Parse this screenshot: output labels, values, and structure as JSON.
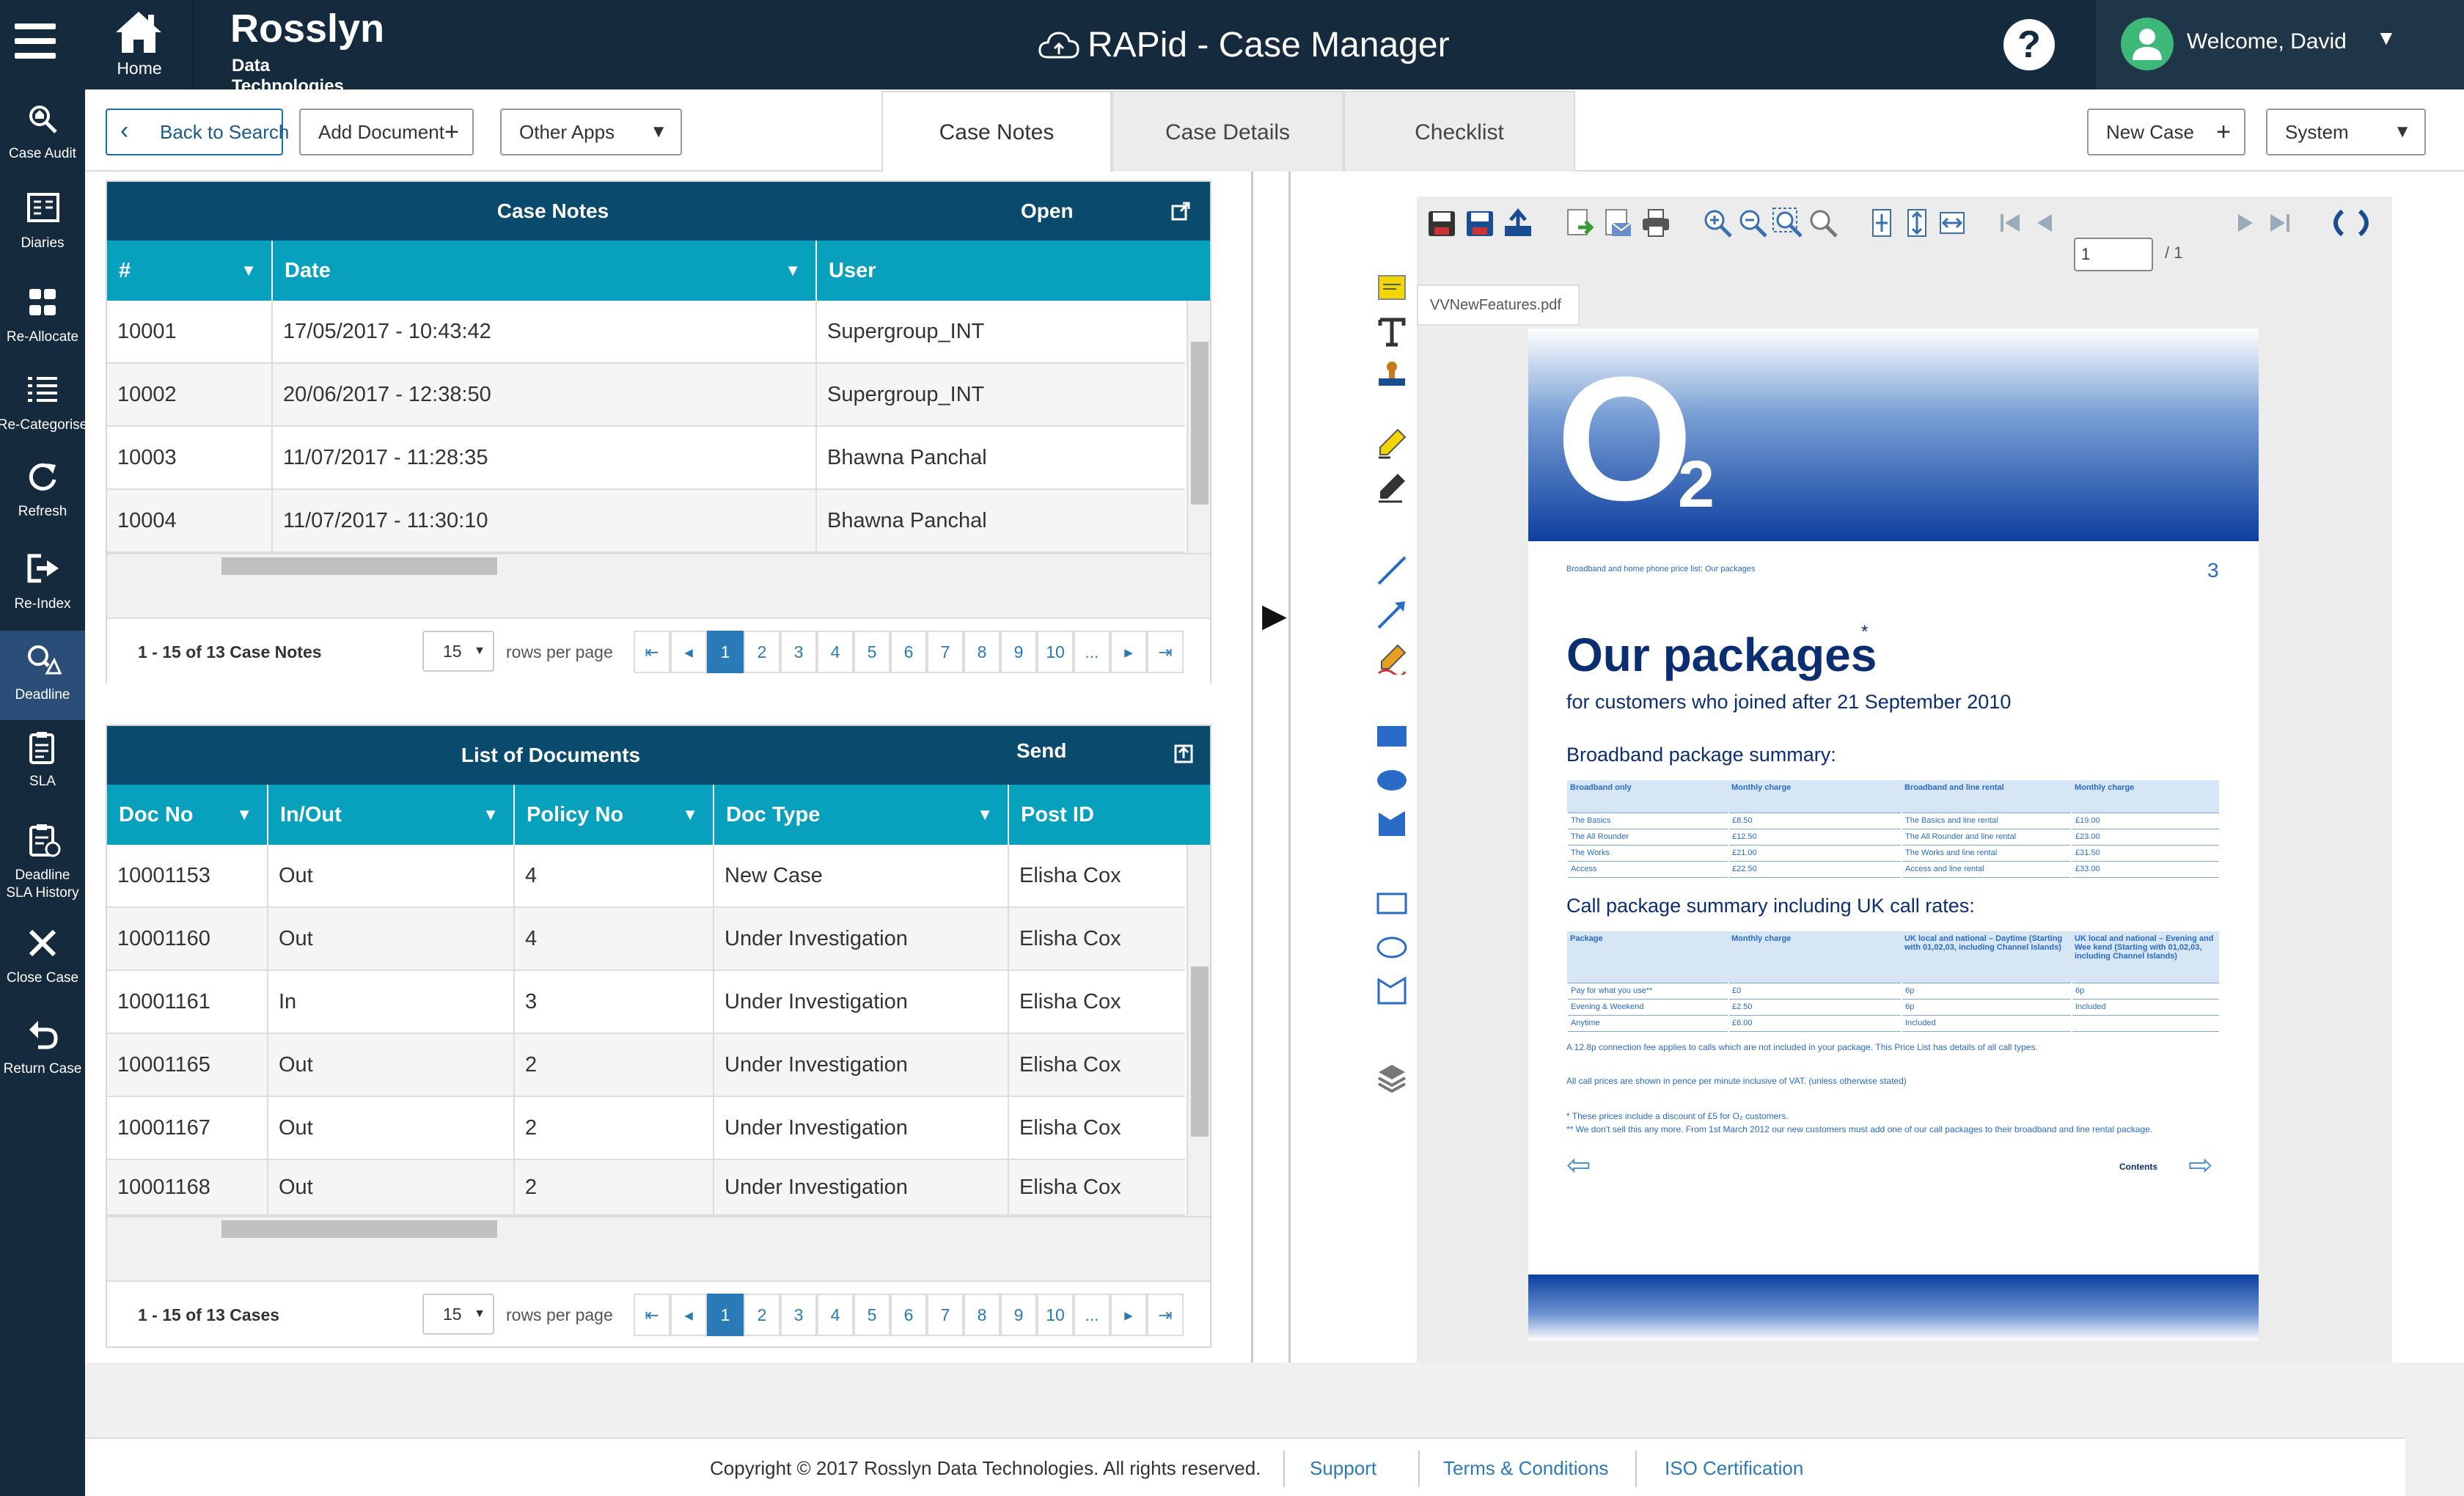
{
  "header": {
    "home_label": "Home",
    "brand_name": "Rosslyn",
    "brand_sub": "Data Technologies",
    "app_title": "RAPid - Case Manager",
    "help_label": "?",
    "welcome": "Welcome, David"
  },
  "sidebar": {
    "items": [
      {
        "label": "Case Audit",
        "icon": "case-audit-icon"
      },
      {
        "label": "Diaries",
        "icon": "diaries-icon"
      },
      {
        "label": "Re-Allocate",
        "icon": "re-allocate-icon"
      },
      {
        "label": "Re-Categorise",
        "icon": "list-icon"
      },
      {
        "label": "Refresh",
        "icon": "refresh-icon"
      },
      {
        "label": "Re-Index",
        "icon": "re-index-icon"
      },
      {
        "label": "Deadline",
        "icon": "deadline-icon"
      },
      {
        "label": "SLA",
        "icon": "sla-icon"
      },
      {
        "label": "Deadline SLA History",
        "icon": "sla-history-icon"
      },
      {
        "label": "Close Case",
        "icon": "close-icon"
      },
      {
        "label": "Return Case",
        "icon": "return-icon"
      }
    ]
  },
  "toolbar": {
    "back_label": "Back to Search",
    "add_doc_label": "Add Document",
    "other_apps_label": "Other Apps",
    "tabs": [
      "Case Notes",
      "Case Details",
      "Checklist"
    ],
    "new_case_label": "New Case",
    "system_label": "System"
  },
  "case_notes": {
    "title": "Case Notes",
    "action": "Open",
    "columns": [
      "#",
      "Date",
      "User"
    ],
    "rows": [
      [
        "10001",
        "17/05/2017 - 10:43:42",
        "Supergroup_INT"
      ],
      [
        "10002",
        "20/06/2017 - 12:38:50",
        "Supergroup_INT"
      ],
      [
        "10003",
        "11/07/2017 - 11:28:35",
        "Bhawna Panchal"
      ],
      [
        "10004",
        "11/07/2017 - 11:30:10",
        "Bhawna Panchal"
      ]
    ],
    "count": "1 - 15 of 13 Case Notes",
    "per_page": "15",
    "rows_per_page_label": "rows per page",
    "pages": [
      "1",
      "2",
      "3",
      "4",
      "5",
      "6",
      "7",
      "8",
      "9",
      "10",
      "..."
    ]
  },
  "documents": {
    "title": "List of Documents",
    "action": "Send",
    "columns": [
      "Doc No",
      "In/Out",
      "Policy No",
      "Doc Type",
      "Post ID"
    ],
    "rows": [
      [
        "10001153",
        "Out",
        "4",
        "New Case",
        "Elisha Cox"
      ],
      [
        "10001160",
        "Out",
        "4",
        "Under Investigation",
        "Elisha Cox"
      ],
      [
        "10001161",
        "In",
        "3",
        "Under Investigation",
        "Elisha Cox"
      ],
      [
        "10001165",
        "Out",
        "2",
        "Under Investigation",
        "Elisha Cox"
      ],
      [
        "10001167",
        "Out",
        "2",
        "Under Investigation",
        "Elisha Cox"
      ],
      [
        "10001168",
        "Out",
        "2",
        "Under Investigation",
        "Elisha Cox"
      ]
    ],
    "count": "1 - 15 of 13 Cases",
    "per_page": "15",
    "rows_per_page_label": "rows per page",
    "pages": [
      "1",
      "2",
      "3",
      "4",
      "5",
      "6",
      "7",
      "8",
      "9",
      "10",
      "..."
    ]
  },
  "viewer": {
    "file_tab": "VVNewFeatures.pdf",
    "page_input": "1",
    "page_of": "/ 1",
    "document": {
      "logo": "O",
      "logo_sub": "2",
      "crumb": "Broadband and home phone price list: Our packages",
      "page_number": "3",
      "heading": "Our packages",
      "heading_mark": "*",
      "subheading": "for customers who joined after 21 September 2010",
      "bb_heading": "Broadband package summary:",
      "bb_columns": [
        "Broadband only",
        "Monthly charge",
        "Broadband and line rental",
        "Monthly charge"
      ],
      "bb_rows": [
        [
          "The Basics",
          "£8.50",
          "The Basics and line rental",
          "£19.00"
        ],
        [
          "The All Rounder",
          "£12.50",
          "The All Rounder and line rental",
          "£23.00"
        ],
        [
          "The Works",
          "£21.00",
          "The Works and line rental",
          "£31.50"
        ],
        [
          "Access",
          "£22.50",
          "Access and line rental",
          "£33.00"
        ]
      ],
      "call_heading": "Call package summary including UK call rates:",
      "call_columns": [
        "Package",
        "Monthly charge",
        "UK local and national – Daytime (Starting with 01,02,03, including Channel Islands)",
        "UK local and national – Evening and Wee kend (Starting with 01,02,03, including Channel Islands)"
      ],
      "call_rows": [
        [
          "Pay for what you use**",
          "£0",
          "6p",
          "6p"
        ],
        [
          "Evening & Weekend",
          "£2.50",
          "6p",
          "Included"
        ],
        [
          "Anytime",
          "£6.00",
          "Included",
          ""
        ]
      ],
      "note1": "A 12.8p connection fee applies to calls which are not included in your package. This Price List has details of all call types.",
      "note2": "All call prices are shown in pence per minute inclusive of VAT. (unless otherwise stated)",
      "note3": "* These prices include a discount of £5 for O₂ customers.",
      "note4": "** We don't sell this any more. From 1st March 2012 our new customers must add one of our call packages to their broadband and line rental package.",
      "contents": "Contents"
    }
  },
  "footer": {
    "copyright": "Copyright © 2017 Rosslyn Data Technologies. All rights reserved.",
    "support": "Support",
    "terms": "Terms & Conditions",
    "iso": "ISO Certification"
  },
  "colors": {
    "nav_bg": "#152a3d",
    "table_header": "#08a1bd",
    "card_header": "#0a4a6c",
    "accent": "#2a7ab8"
  }
}
